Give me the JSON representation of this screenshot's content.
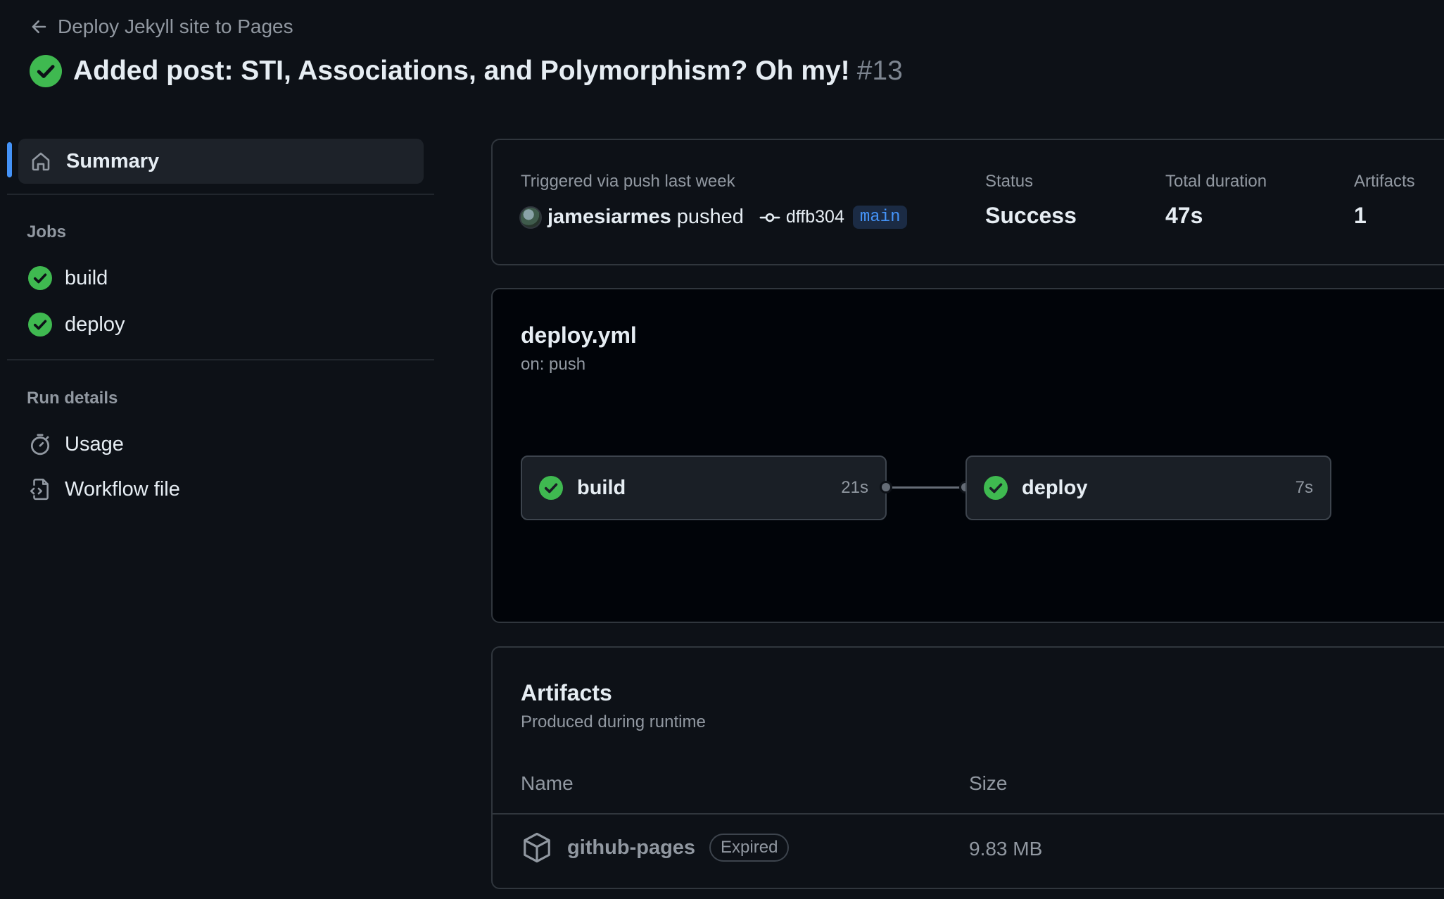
{
  "header": {
    "back_label": "Deploy Jekyll site to Pages",
    "run_title": "Added post: STI, Associations, and Polymorphism? Oh my!",
    "run_number": "#13"
  },
  "sidebar": {
    "summary_label": "Summary",
    "jobs_heading": "Jobs",
    "jobs": [
      {
        "label": "build",
        "status": "success"
      },
      {
        "label": "deploy",
        "status": "success"
      }
    ],
    "run_details_heading": "Run details",
    "run_details": [
      {
        "label": "Usage",
        "icon": "stopwatch-icon"
      },
      {
        "label": "Workflow file",
        "icon": "file-code-icon"
      }
    ]
  },
  "summary_card": {
    "trigger_label": "Triggered via push last week",
    "actor": "jamesiarmes",
    "action": "pushed",
    "commit": "dffb304",
    "branch": "main",
    "status_label": "Status",
    "status_value": "Success",
    "duration_label": "Total duration",
    "duration_value": "47s",
    "artifacts_label": "Artifacts",
    "artifacts_value": "1"
  },
  "workflow_card": {
    "file_name": "deploy.yml",
    "trigger": "on: push",
    "jobs": [
      {
        "name": "build",
        "duration": "21s"
      },
      {
        "name": "deploy",
        "duration": "7s"
      }
    ]
  },
  "artifacts_card": {
    "title": "Artifacts",
    "subtitle": "Produced during runtime",
    "col_name": "Name",
    "col_size": "Size",
    "rows": [
      {
        "name": "github-pages",
        "badge": "Expired",
        "size": "9.83 MB"
      }
    ]
  },
  "colors": {
    "success": "#3fb950",
    "accent": "#4493f8",
    "bg": "#0d1117"
  }
}
